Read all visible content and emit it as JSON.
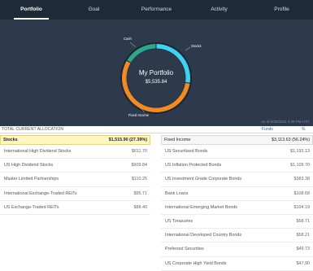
{
  "nav": {
    "tabs": [
      {
        "label": "Portfolio"
      },
      {
        "label": "Goal"
      },
      {
        "label": "Performance"
      },
      {
        "label": "Activity"
      },
      {
        "label": "Profile"
      }
    ]
  },
  "hero": {
    "title": "My Portfolio",
    "total": "$5,535.84",
    "labels": {
      "cash": "Cash",
      "stocks": "Stocks",
      "fixed_income": "Fixed Income"
    },
    "as_of": "As of 6/30/2025 3:49 PM UTC",
    "allocation_pct": {
      "stocks": 27.39,
      "fixed_income": 56.24,
      "cash": 16.37
    },
    "colors": {
      "stocks": "#3ed1f2",
      "fixed_income": "#f08a24",
      "cash": "#2aa889",
      "background": "#2c3a4c",
      "nav": "#1f2a38"
    }
  },
  "allocation": {
    "title": "TOTAL CURRENT ALLOCATION",
    "funds_label": "Funds",
    "pct_label": "%"
  },
  "stocks": {
    "name": "Stocks",
    "amount": "$1,515.90 (27.39%)",
    "items": [
      {
        "name": "International High Dividend Stocks",
        "amount": "$611.70"
      },
      {
        "name": "US High Dividend Stocks",
        "amount": "$609.84"
      },
      {
        "name": "Master Limited Partnerships",
        "amount": "$110.25"
      },
      {
        "name": "International Exchange-Traded REITs",
        "amount": "$95.71"
      },
      {
        "name": "US Exchange-Traded REITs",
        "amount": "$88.40"
      }
    ]
  },
  "fixed_income": {
    "name": "Fixed Income",
    "amount": "$3,113.63 (56.24%)",
    "items": [
      {
        "name": "US Securitized Bonds",
        "amount": "$1,193.13"
      },
      {
        "name": "US Inflation Protected Bonds",
        "amount": "$1,109.70"
      },
      {
        "name": "US Investment Grade Corporate Bonds",
        "amount": "$383.38"
      },
      {
        "name": "Bank Loans",
        "amount": "$108.68"
      },
      {
        "name": "International Emerging Market Bonds",
        "amount": "$104.19"
      },
      {
        "name": "US Treasuries",
        "amount": "$58.71"
      },
      {
        "name": "International Developed Country Bonds",
        "amount": "$58.21"
      },
      {
        "name": "Preferred Securities",
        "amount": "$49.73"
      },
      {
        "name": "US Corporate High Yield Bonds",
        "amount": "$47.90"
      }
    ]
  }
}
